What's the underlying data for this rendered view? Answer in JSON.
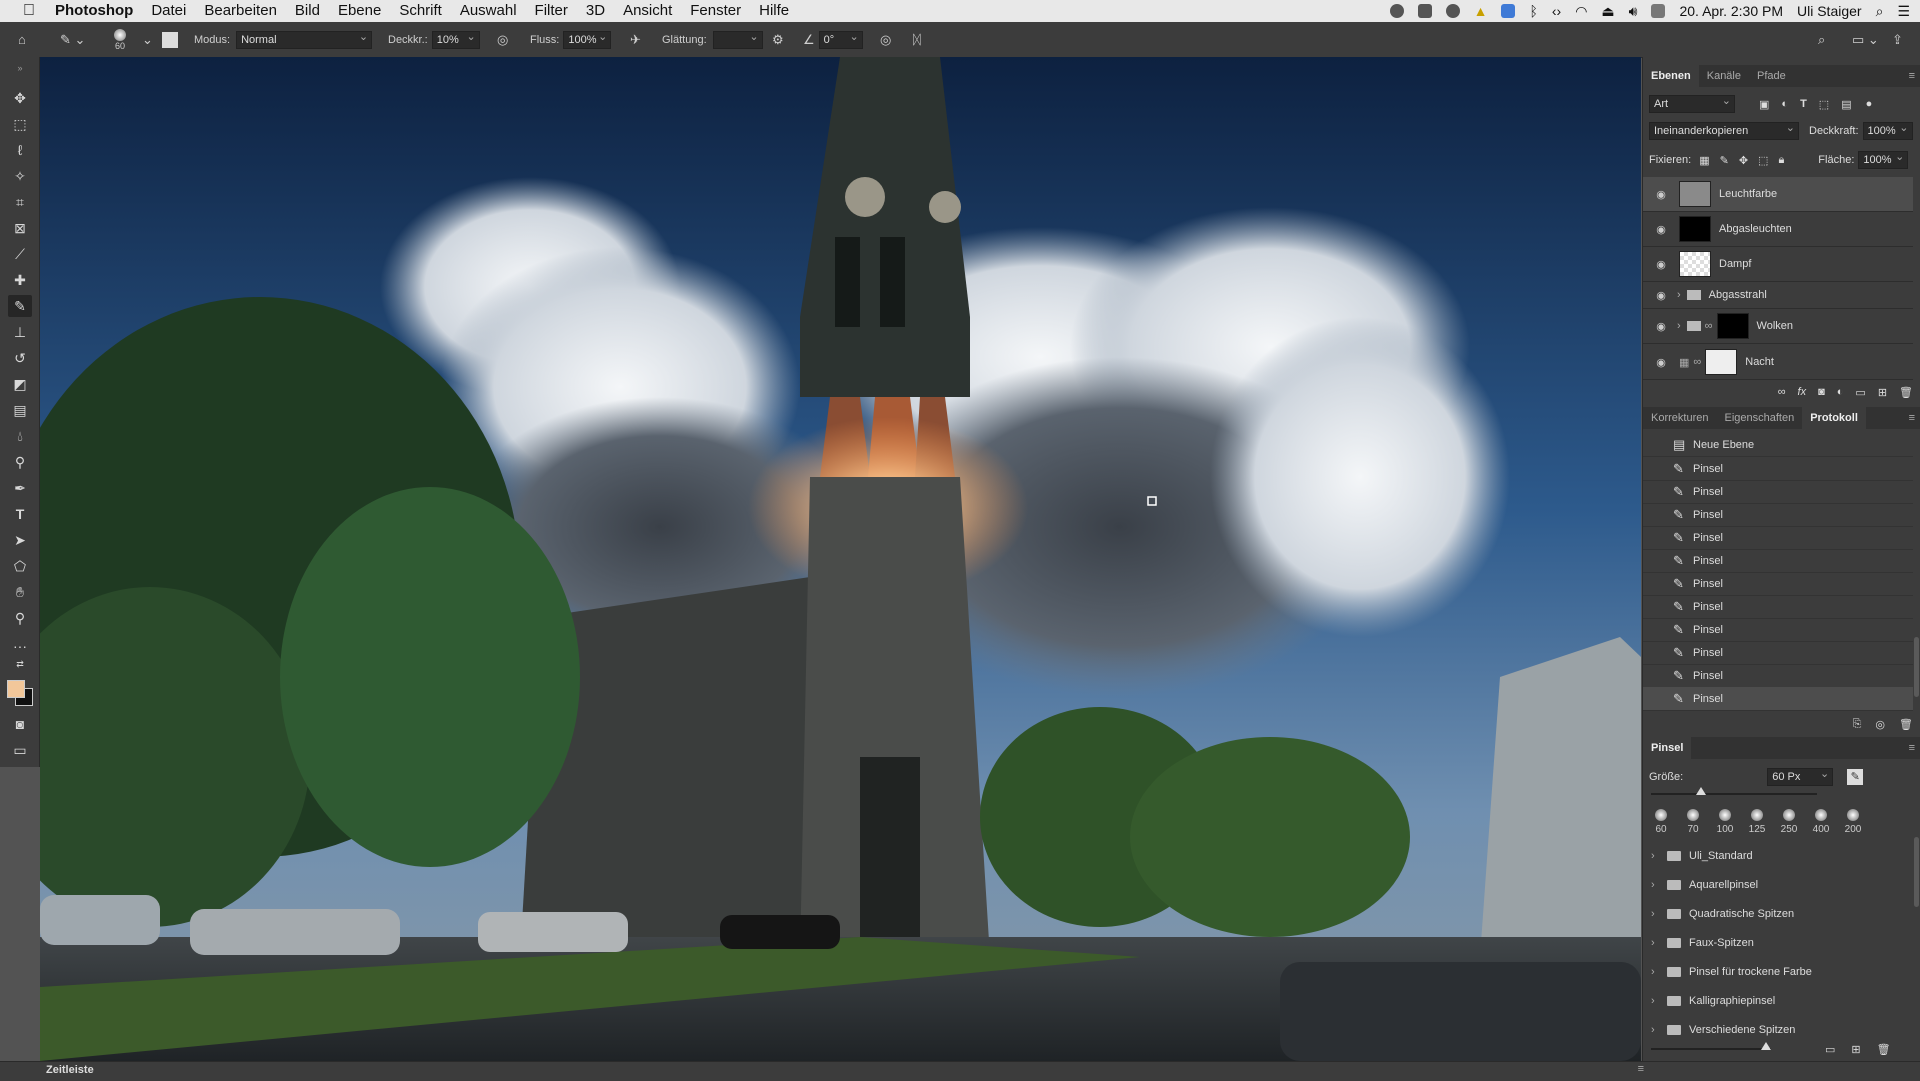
{
  "menubar": {
    "app": "Photoshop",
    "items": [
      "Datei",
      "Bearbeiten",
      "Bild",
      "Ebene",
      "Schrift",
      "Auswahl",
      "Filter",
      "3D",
      "Ansicht",
      "Fenster",
      "Hilfe"
    ],
    "clock": "20. Apr. 2:30 PM",
    "user": "Uli Staiger"
  },
  "options": {
    "brush_size": "60",
    "mode_label": "Modus:",
    "mode_value": "Normal",
    "opacity_label": "Deckkr.:",
    "opacity_value": "10%",
    "flow_label": "Fluss:",
    "flow_value": "100%",
    "smoothing_label": "Glättung:",
    "smoothing_value": "",
    "angle_value": "0°"
  },
  "layers_panel": {
    "tabs": [
      "Ebenen",
      "Kanäle",
      "Pfade"
    ],
    "filter_label": "Art",
    "blend_mode": "Ineinanderkopieren",
    "opacity_label": "Deckkraft:",
    "opacity_value": "100%",
    "lock_label": "Fixieren:",
    "fill_label": "Fläche:",
    "fill_value": "100%",
    "layers": [
      {
        "name": "Leuchtfarbe",
        "selected": true
      },
      {
        "name": "Abgasleuchten",
        "selected": false
      },
      {
        "name": "Dampf",
        "selected": false
      },
      {
        "name": "Abgasstrahl",
        "selected": false
      },
      {
        "name": "Wolken",
        "selected": false
      },
      {
        "name": "Nacht",
        "selected": false
      }
    ]
  },
  "history_panel": {
    "tabs": [
      "Korrekturen",
      "Eigenschaften",
      "Protokoll"
    ],
    "first_item": "Neue Ebene",
    "items": [
      "Pinsel",
      "Pinsel",
      "Pinsel",
      "Pinsel",
      "Pinsel",
      "Pinsel",
      "Pinsel",
      "Pinsel",
      "Pinsel",
      "Pinsel",
      "Pinsel"
    ]
  },
  "brush_panel": {
    "title": "Pinsel",
    "size_label": "Größe:",
    "size_value": "60 Px",
    "size_fraction": 0.3,
    "presets": [
      "60",
      "70",
      "100",
      "125",
      "250",
      "400",
      "200"
    ],
    "folders": [
      "Uli_Standard",
      "Aquarellpinsel",
      "Quadratische Spitzen",
      "Faux-Spitzen",
      "Pinsel für trockene Farbe",
      "Kalligraphiepinsel",
      "Verschiedene Spitzen"
    ]
  },
  "statusbar": {
    "timeline": "Zeitleiste"
  },
  "colors": {
    "foreground": "#f2c79a",
    "background": "#111111",
    "ui_dark": "#3c3c3c",
    "ui_panel_dark": "#323232"
  }
}
